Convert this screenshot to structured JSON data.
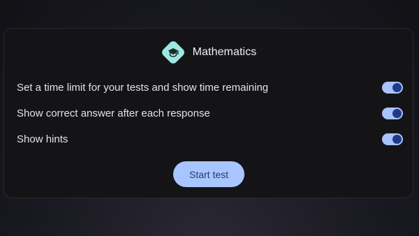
{
  "app": {
    "title": "Mathematics",
    "icon": "graduation-cap-icon"
  },
  "settings": [
    {
      "label": "Set a time limit for your tests and show time remaining",
      "enabled": true
    },
    {
      "label": "Show correct answer after each response",
      "enabled": true
    },
    {
      "label": "Show hints",
      "enabled": true
    }
  ],
  "actions": {
    "start_label": "Start test"
  },
  "colors": {
    "accent": "#a9c5ff",
    "knob": "#1f3a86",
    "logo": "#9ee7e2"
  }
}
